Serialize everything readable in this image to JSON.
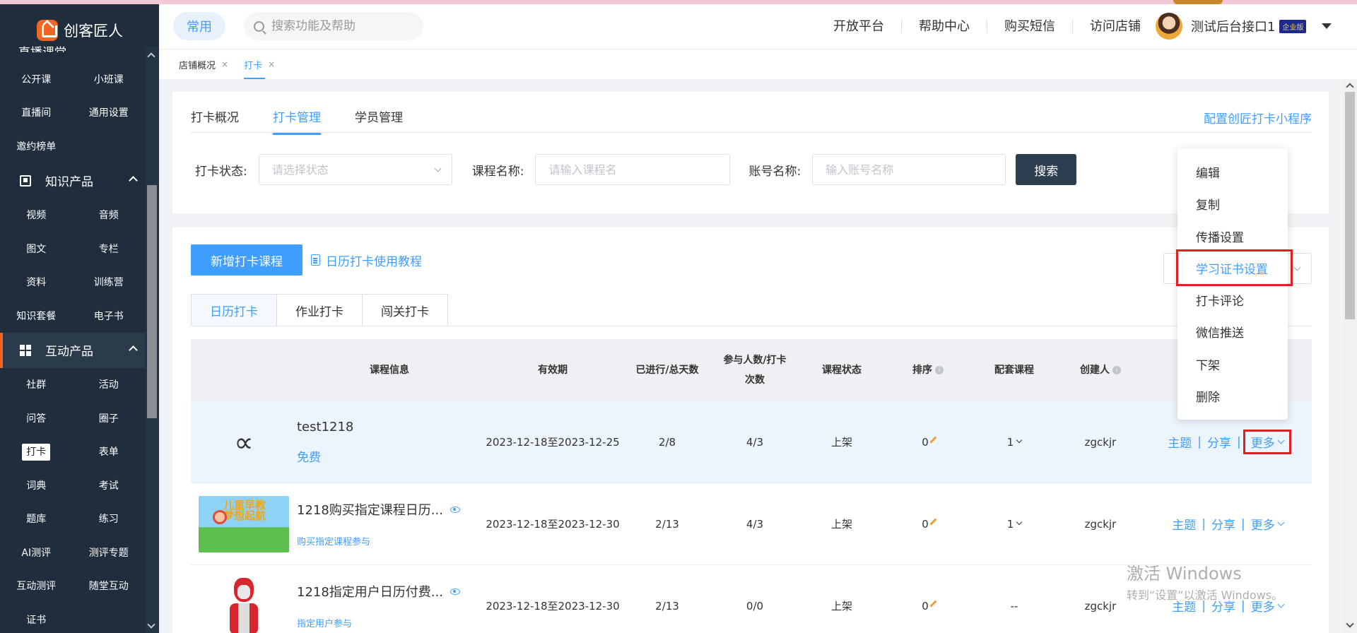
{
  "app": {
    "logo_text": "创客匠人"
  },
  "sidebar": {
    "cut_title": "直播课堂",
    "live_items": [
      [
        "公开课",
        "小班课"
      ],
      [
        "直播间",
        "通用设置"
      ],
      [
        "邀约榜单",
        ""
      ]
    ],
    "knowledge": {
      "title": "知识产品",
      "items": [
        [
          "视频",
          "音频"
        ],
        [
          "图文",
          "专栏"
        ],
        [
          "资料",
          "训练营"
        ],
        [
          "知识套餐",
          "电子书"
        ]
      ]
    },
    "interactive": {
      "title": "互动产品",
      "items": [
        [
          "社群",
          "活动"
        ],
        [
          "问答",
          "圈子"
        ],
        [
          "打卡",
          "表单"
        ],
        [
          "词典",
          "考试"
        ],
        [
          "题库",
          "练习"
        ],
        [
          "AI测评",
          "测评专题"
        ],
        [
          "互动测评",
          "随堂互动"
        ],
        [
          "证书",
          ""
        ]
      ]
    },
    "active_item": "打卡"
  },
  "header": {
    "pill": "常用",
    "search_placeholder": "搜索功能及帮助",
    "nav": [
      "开放平台",
      "帮助中心",
      "购买短信",
      "访问店铺"
    ],
    "user_name": "测试后台接口1",
    "badge": "企业版"
  },
  "crumbs": [
    {
      "label": "店铺概况",
      "active": false
    },
    {
      "label": "打卡",
      "active": true
    }
  ],
  "crumb_close": "×",
  "subtabs": [
    {
      "label": "打卡概况",
      "active": false
    },
    {
      "label": "打卡管理",
      "active": true
    },
    {
      "label": "学员管理",
      "active": false
    }
  ],
  "config_link": "配置创匠打卡小程序",
  "filters": {
    "status_label": "打卡状态:",
    "status_placeholder": "请选择状态",
    "course_label": "课程名称:",
    "course_placeholder": "请输入课程名",
    "account_label": "账号名称:",
    "account_placeholder": "输入账号名称",
    "search_btn": "搜索"
  },
  "actions": {
    "add_btn": "新增打卡课程",
    "tutorial": "日历打卡使用教程"
  },
  "type_tabs": [
    {
      "label": "日历打卡",
      "active": true
    },
    {
      "label": "作业打卡",
      "active": false
    },
    {
      "label": "闯关打卡",
      "active": false
    }
  ],
  "table": {
    "headers": {
      "info": "课程信息",
      "valid": "有效期",
      "days": "已进行/总天数",
      "part1": "参与人数/打卡",
      "part2": "次数",
      "status": "课程状态",
      "sort": "排序",
      "peitao": "配套课程",
      "creator": "创建人"
    },
    "rows": [
      {
        "title": "test1218",
        "sub": "免费",
        "valid": "2023-12-18至2023-12-25",
        "days": "2/8",
        "part": "4/3",
        "status": "上架",
        "sort": "0",
        "peitao": "1",
        "creator": "zgckjr",
        "ops": [
          "主题",
          "分享",
          "更多"
        ],
        "thumb_text": "∝"
      },
      {
        "title": "1218购买指定课程日历...",
        "sub": "购买指定课程参与",
        "valid": "2023-12-18至2023-12-30",
        "days": "2/13",
        "part": "4/3",
        "status": "上架",
        "sort": "0",
        "peitao": "1",
        "creator": "zgckjr",
        "ops": [
          "主题",
          "分享",
          "更多"
        ],
        "thumb_text": "儿童早教梦想起航"
      },
      {
        "title": "1218指定用户日历付费...",
        "sub": "指定用户参与",
        "valid": "2023-12-18至2023-12-30",
        "days": "2/13",
        "part": "0/0",
        "status": "上架",
        "sort": "0",
        "peitao": "--",
        "creator": "zgckjr",
        "ops": [
          "主题",
          "分享",
          "更多"
        ],
        "thumb_text": ""
      }
    ]
  },
  "dropdown": [
    "编辑",
    "复制",
    "传播设置",
    "学习证书设置",
    "打卡评论",
    "微信推送",
    "下架",
    "删除"
  ],
  "dropdown_active": "学习证书设置",
  "watermark": {
    "line1": "激活 Windows",
    "line2": "转到“设置”以激活 Windows。"
  },
  "colors": {
    "accent": "#409eff",
    "brand": "#f26522",
    "sidebar": "#1f2d3d",
    "highlight_box": "#e02020"
  }
}
